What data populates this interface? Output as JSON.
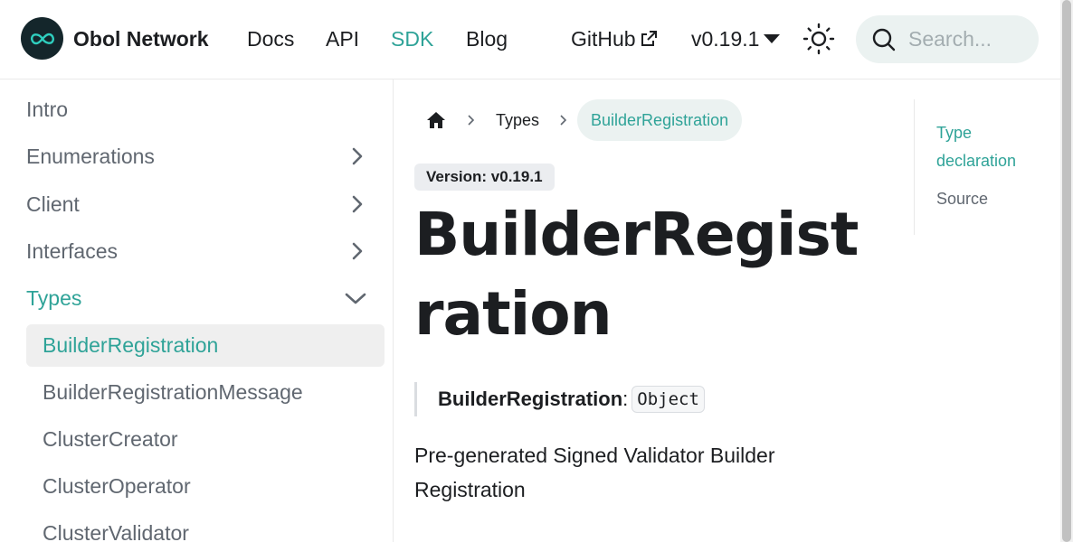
{
  "navbar": {
    "brand": "Obol Network",
    "links": [
      {
        "label": "Docs"
      },
      {
        "label": "API"
      },
      {
        "label": "SDK",
        "active": true
      },
      {
        "label": "Blog"
      }
    ],
    "github_label": "GitHub",
    "version_label": "v0.19.1",
    "search_placeholder": "Search...",
    "accent_color": "#2fa398",
    "icons": [
      "obol-logo-icon",
      "external-link-icon",
      "chevron-down-icon",
      "sun-icon",
      "search-icon"
    ]
  },
  "sidebar": {
    "categories": [
      {
        "label": "Intro",
        "expandable": false
      },
      {
        "label": "Enumerations",
        "expandable": true,
        "expanded": false
      },
      {
        "label": "Client",
        "expandable": true,
        "expanded": false
      },
      {
        "label": "Interfaces",
        "expandable": true,
        "expanded": false
      },
      {
        "label": "Types",
        "expandable": true,
        "expanded": true,
        "active": true
      }
    ],
    "types_items": [
      {
        "label": "BuilderRegistration",
        "active": true
      },
      {
        "label": "BuilderRegistrationMessage"
      },
      {
        "label": "ClusterCreator"
      },
      {
        "label": "ClusterOperator"
      },
      {
        "label": "ClusterValidator"
      }
    ]
  },
  "breadcrumb": {
    "items": [
      {
        "label": "Types"
      },
      {
        "label": "BuilderRegistration",
        "active": true
      }
    ]
  },
  "main": {
    "version_badge": "Version: v0.19.1",
    "title": "BuilderRegistration",
    "declaration_name": "BuilderRegistration",
    "declaration_sep": ":",
    "declaration_type": "Object",
    "description": "Pre-generated Signed Validator Builder Registration"
  },
  "toc": {
    "items": [
      {
        "label": "Type declaration",
        "active": true
      },
      {
        "label": "Source"
      }
    ]
  }
}
